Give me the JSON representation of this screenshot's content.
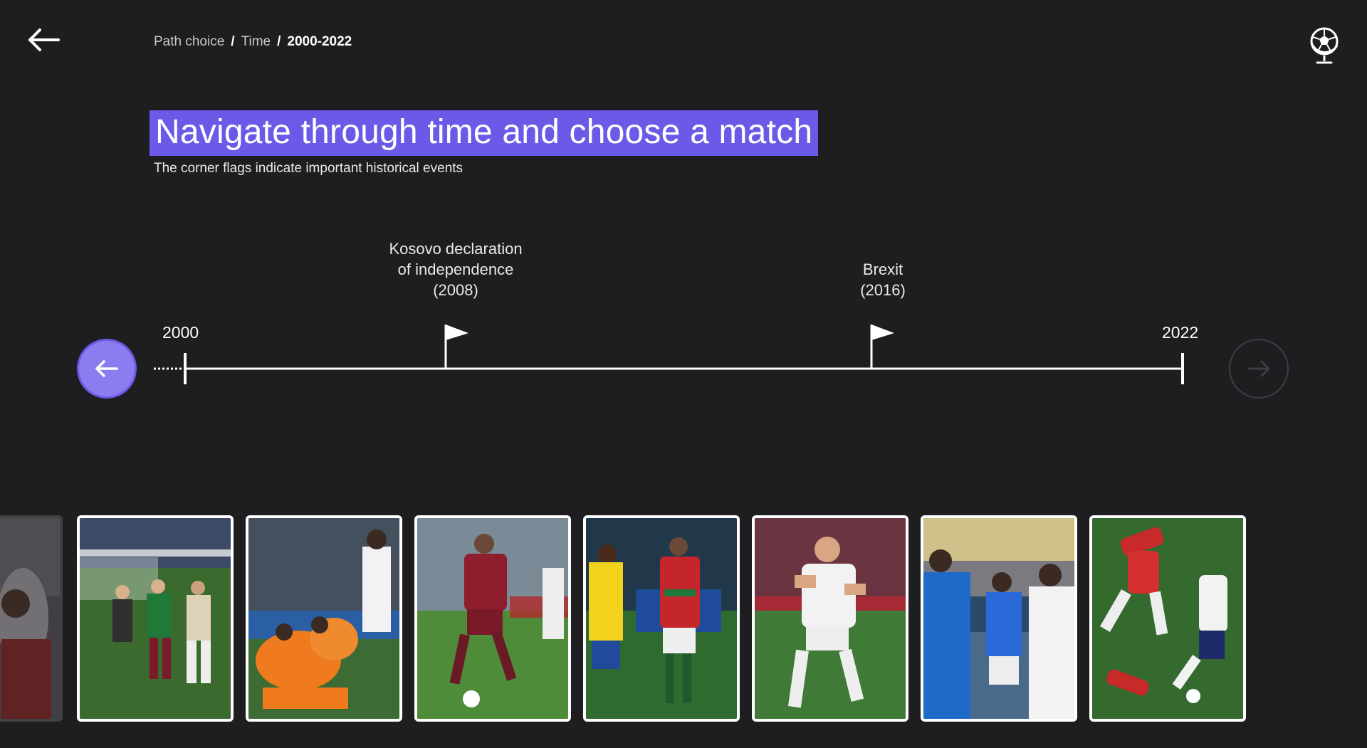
{
  "header": {
    "back_icon": "arrow-left-icon",
    "globe_icon": "football-globe-icon",
    "breadcrumb": [
      {
        "label": "Path choice"
      },
      {
        "label": "Time"
      },
      {
        "label": "2000-2022"
      }
    ],
    "breadcrumb_separator": "/"
  },
  "main": {
    "title": "Navigate through time and choose a match",
    "subtitle": "The corner flags indicate important historical events"
  },
  "timeline": {
    "start_year": "2000",
    "end_year": "2022",
    "prev_icon": "arrow-left-icon",
    "next_icon": "arrow-right-icon",
    "events": [
      {
        "lines": [
          "Kosovo declaration",
          "of independence",
          "(2008)"
        ],
        "year": 2008,
        "icon": "corner-flag-icon"
      },
      {
        "lines": [
          "Brexit",
          "(2016)"
        ],
        "year": 2016,
        "icon": "corner-flag-icon"
      }
    ]
  },
  "matches": [
    {
      "scene": "celebration-stand",
      "state": "partially-visible"
    },
    {
      "scene": "pitch-invasion",
      "state": "visible"
    },
    {
      "scene": "team-huddle-orange",
      "state": "visible"
    },
    {
      "scene": "player-dribbling-red",
      "state": "visible"
    },
    {
      "scene": "handshake",
      "state": "visible"
    },
    {
      "scene": "goal-celebration-white",
      "state": "visible"
    },
    {
      "scene": "players-walking-blue",
      "state": "visible"
    },
    {
      "scene": "aerial-tackle",
      "state": "visible"
    }
  ],
  "colors": {
    "background": "#1e1d1f",
    "accent": "#6b5ae8",
    "accent_light": "#8b7df0",
    "text": "#ffffff"
  }
}
